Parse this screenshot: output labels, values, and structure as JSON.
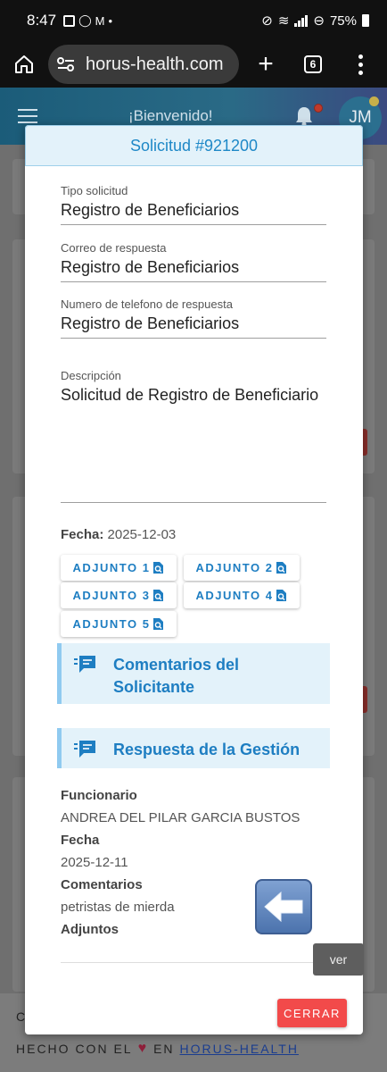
{
  "status_bar": {
    "time": "8:47",
    "battery": "75%"
  },
  "browser": {
    "url": "horus-health.com",
    "tab_count": "6"
  },
  "app_header": {
    "welcome": "¡Bienvenido!",
    "avatar_initials": "JM"
  },
  "modal": {
    "title": "Solicitud #921200",
    "fields": [
      {
        "label": "Tipo solicitud",
        "value": "Registro de Beneficiarios"
      },
      {
        "label": "Correo de respuesta",
        "value": "Registro de Beneficiarios"
      },
      {
        "label": "Numero de telefono de respuesta",
        "value": "Registro de Beneficiarios"
      }
    ],
    "description": {
      "label": "Descripción",
      "value": "Solicitud de Registro de Beneficiario"
    },
    "fecha_label": "Fecha:",
    "fecha_value": "2025-12-03",
    "attachments": [
      "ADJUNTO 1",
      "ADJUNTO 2",
      "ADJUNTO 3",
      "ADJUNTO 4",
      "ADJUNTO 5"
    ],
    "section_comments": "Comentarios del Solicitante",
    "section_response": "Respuesta de la Gestión",
    "response": {
      "funcionario_label": "Funcionario",
      "funcionario_value": "ANDREA DEL PILAR GARCIA BUSTOS",
      "fecha_label": "Fecha",
      "fecha_value": "2025-12-11",
      "comentarios_label": "Comentarios",
      "comentarios_value": "petristas de mierda",
      "adjuntos_label": "Adjuntos"
    },
    "ver_label": "ver",
    "close_label": "CERRAR"
  },
  "footer": {
    "partial": "C",
    "made_with": "HECHO CON EL",
    "en": "EN",
    "link": "HORUS-HEALTH"
  },
  "colors": {
    "accent": "#1e7ec2",
    "header_bg": "#e3f2fa",
    "close": "#f24a4a"
  }
}
